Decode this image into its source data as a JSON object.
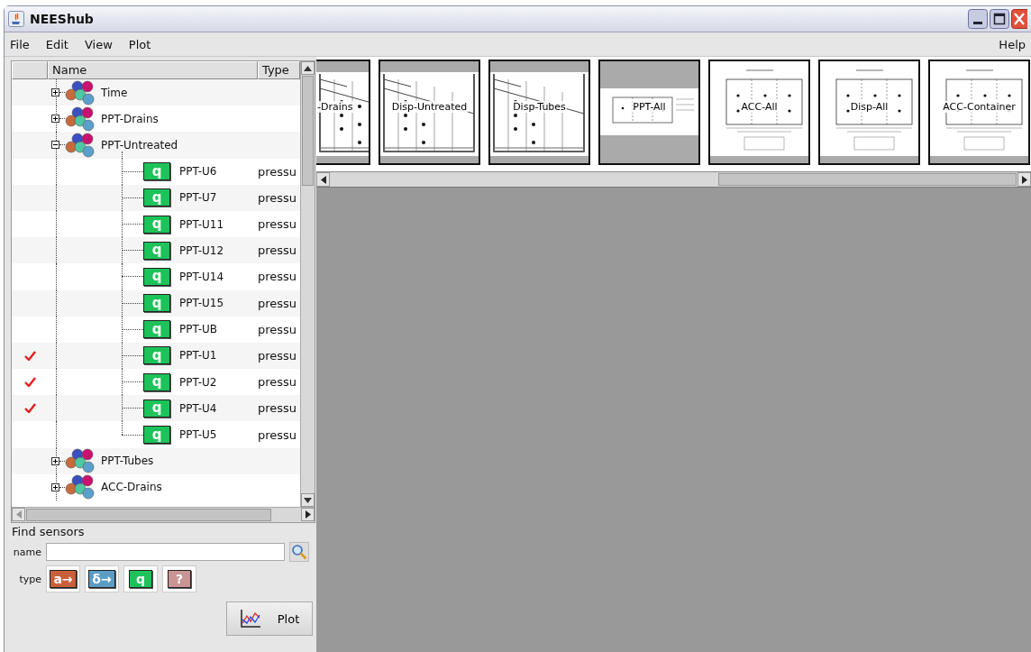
{
  "window": {
    "title": "NEEShub"
  },
  "menu": [
    "File",
    "Edit",
    "View",
    "Plot"
  ],
  "help_menu": "Help",
  "tree": {
    "columns": [
      "Name",
      "Type"
    ],
    "rows": [
      {
        "kind": "group",
        "label": "Time",
        "expanded": false
      },
      {
        "kind": "group",
        "label": "PPT-Drains",
        "expanded": false
      },
      {
        "kind": "group",
        "label": "PPT-Untreated",
        "expanded": true,
        "children": [
          {
            "kind": "sensor",
            "badge": "q",
            "label": "PPT-U6",
            "type": "pressu",
            "checked": false
          },
          {
            "kind": "sensor",
            "badge": "q",
            "label": "PPT-U7",
            "type": "pressu",
            "checked": false
          },
          {
            "kind": "sensor",
            "badge": "q",
            "label": "PPT-U11",
            "type": "pressu",
            "checked": false
          },
          {
            "kind": "sensor",
            "badge": "q",
            "label": "PPT-U12",
            "type": "pressu",
            "checked": false
          },
          {
            "kind": "sensor",
            "badge": "q",
            "label": "PPT-U14",
            "type": "pressu",
            "checked": false
          },
          {
            "kind": "sensor",
            "badge": "q",
            "label": "PPT-U15",
            "type": "pressu",
            "checked": false
          },
          {
            "kind": "sensor",
            "badge": "q",
            "label": "PPT-UB",
            "type": "pressu",
            "checked": false
          },
          {
            "kind": "sensor",
            "badge": "q",
            "label": "PPT-U1",
            "type": "pressu",
            "checked": true
          },
          {
            "kind": "sensor",
            "badge": "q",
            "label": "PPT-U2",
            "type": "pressu",
            "checked": true
          },
          {
            "kind": "sensor",
            "badge": "q",
            "label": "PPT-U4",
            "type": "pressu",
            "checked": true
          },
          {
            "kind": "sensor",
            "badge": "q",
            "label": "PPT-U5",
            "type": "pressu",
            "checked": false
          }
        ]
      },
      {
        "kind": "group",
        "label": "PPT-Tubes",
        "expanded": false
      },
      {
        "kind": "group",
        "label": "ACC-Drains",
        "expanded": false
      }
    ]
  },
  "find_sensors": {
    "title": "Find sensors",
    "name_label": "name",
    "type_label": "type",
    "types": [
      {
        "glyph": "a→",
        "color": "#c8603c"
      },
      {
        "glyph": "δ→",
        "color": "#5b9cc4"
      },
      {
        "glyph": "q",
        "color": "#1ec25a"
      },
      {
        "glyph": "?",
        "color": "#c99494"
      }
    ]
  },
  "plot_button": "Plot",
  "thumbnails": [
    {
      "kind": "soil",
      "label": "-Drains",
      "cut": true
    },
    {
      "kind": "soil",
      "label": "Disp-Untreated",
      "cut": false
    },
    {
      "kind": "soil",
      "label": "Disp-Tubes",
      "cut": false
    },
    {
      "kind": "wide",
      "label": "PPT-All",
      "cut": false
    },
    {
      "kind": "plot",
      "label": "ACC-All",
      "cut": false
    },
    {
      "kind": "plot",
      "label": "Disp-All",
      "cut": false
    },
    {
      "kind": "plot",
      "label": "ACC-Container",
      "cut": false
    }
  ]
}
